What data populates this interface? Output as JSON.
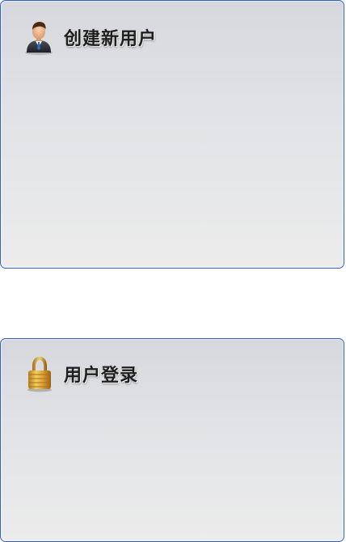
{
  "create_user_panel": {
    "title": "创建新用户",
    "icon": "user-avatar-icon"
  },
  "login_panel": {
    "title": "用户登录",
    "icon": "padlock-icon"
  },
  "colors": {
    "panel_border": "#2f5fc8",
    "panel_bg_top": "#d6d8dd",
    "panel_bg_bottom": "#ececec",
    "title_text": "#1e1e1e"
  }
}
